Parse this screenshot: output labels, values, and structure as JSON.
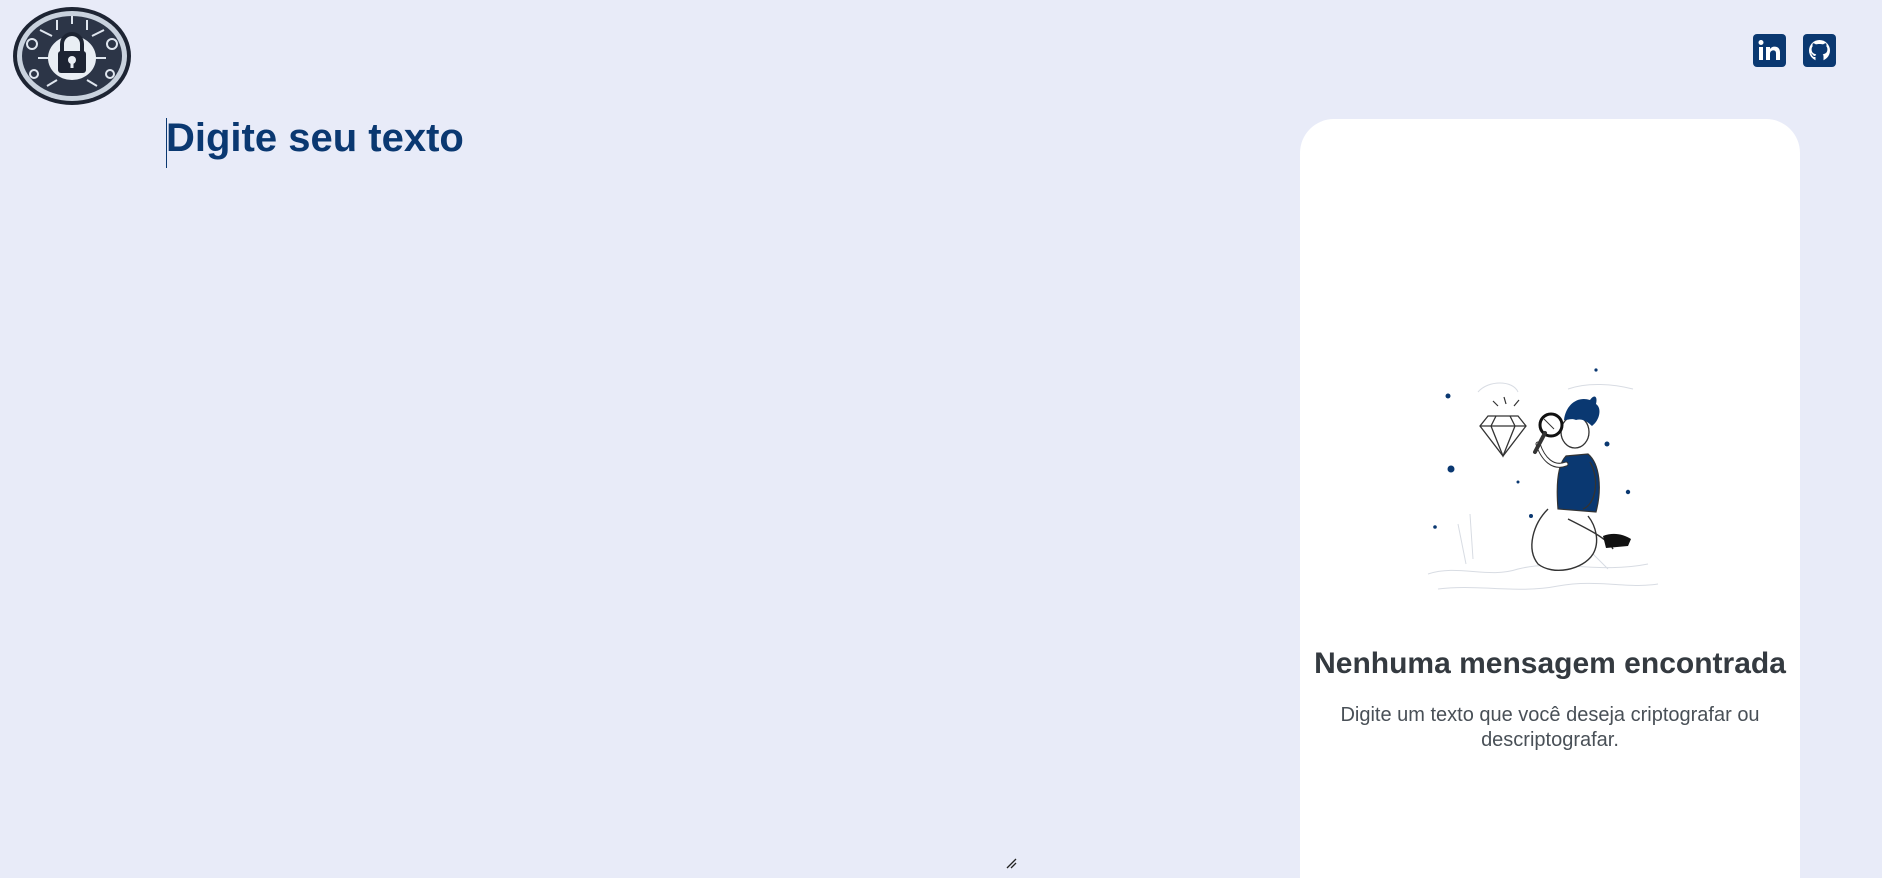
{
  "header": {
    "logo_name": "lock-emblem-logo",
    "social": [
      {
        "name": "linkedin-icon",
        "label": "in"
      },
      {
        "name": "github-icon",
        "label": ""
      }
    ]
  },
  "editor": {
    "placeholder": "Digite seu texto",
    "value": ""
  },
  "output_panel": {
    "title": "Nenhuma mensagem encontrada",
    "text": "Digite um texto que você deseja criptografar ou descriptografar."
  },
  "colors": {
    "background": "#e8ebf8",
    "primary": "#0a3871",
    "panel": "#ffffff",
    "title_text": "#343a40",
    "body_text": "#495057"
  }
}
